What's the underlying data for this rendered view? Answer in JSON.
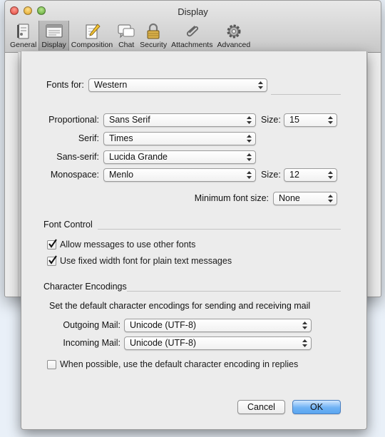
{
  "window": {
    "title": "Display",
    "toolbar": [
      {
        "label": "General",
        "icon": "general-icon",
        "selected": false
      },
      {
        "label": "Display",
        "icon": "display-icon",
        "selected": true
      },
      {
        "label": "Composition",
        "icon": "composition-icon",
        "selected": false
      },
      {
        "label": "Chat",
        "icon": "chat-icon",
        "selected": false
      },
      {
        "label": "Security",
        "icon": "lock-icon",
        "selected": false
      },
      {
        "label": "Attachments",
        "icon": "paperclip-icon",
        "selected": false
      },
      {
        "label": "Advanced",
        "icon": "gear-icon",
        "selected": false
      }
    ]
  },
  "fonts": {
    "fonts_for_label": "Fonts for:",
    "fonts_for_value": "Western",
    "proportional_label": "Proportional:",
    "proportional_value": "Sans Serif",
    "proportional_size_label": "Size:",
    "proportional_size_value": "15",
    "serif_label": "Serif:",
    "serif_value": "Times",
    "sans_serif_label": "Sans-serif:",
    "sans_serif_value": "Lucida Grande",
    "monospace_label": "Monospace:",
    "monospace_value": "Menlo",
    "monospace_size_label": "Size:",
    "monospace_size_value": "12",
    "min_font_size_label": "Minimum font size:",
    "min_font_size_value": "None"
  },
  "font_control": {
    "title": "Font Control",
    "allow_other_fonts_label": "Allow messages to use other fonts",
    "allow_other_fonts_checked": true,
    "fixed_width_label": "Use fixed width font for plain text messages",
    "fixed_width_checked": true
  },
  "encodings": {
    "title": "Character Encodings",
    "description": "Set the default character encodings for sending and receiving mail",
    "outgoing_label": "Outgoing Mail:",
    "outgoing_value": "Unicode (UTF-8)",
    "incoming_label": "Incoming Mail:",
    "incoming_value": "Unicode (UTF-8)",
    "default_in_replies_label": "When possible, use the default character encoding in replies",
    "default_in_replies_checked": false
  },
  "buttons": {
    "cancel": "Cancel",
    "ok": "OK"
  },
  "colors": {
    "desktop": "#e9f0f8",
    "default_button": "#5aa6f0"
  }
}
